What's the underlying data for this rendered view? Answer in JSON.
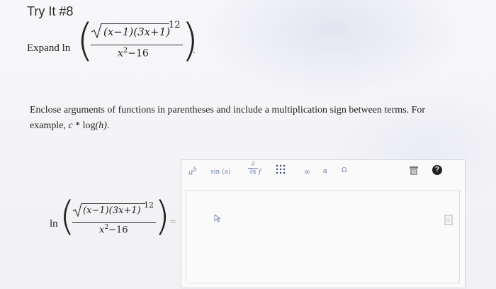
{
  "heading": "Try It #8",
  "expand": {
    "label": "Expand ln",
    "numerator": "(x−1)(3x+1)",
    "exponent": "12",
    "denominator": "x²−16",
    "denominator_base": "x",
    "denominator_power": "2",
    "denominator_rest": "−16",
    "trailing_period": "."
  },
  "instructions": {
    "line1": "Enclose arguments of functions in parentheses and include a multiplication sign between terms. For",
    "line2_prefix": "example, ",
    "line2_c": "c",
    "line2_star": " * ",
    "line2_log": "log",
    "line2_arg": "(h)",
    "line2_suffix": "."
  },
  "answer": {
    "ln_label": "ln",
    "equals": "="
  },
  "toolbar": {
    "power": "a",
    "power_sup": "b",
    "sin": "sin (a)",
    "partial_top": "∂",
    "partial_bottom": "∂x",
    "partial_f": "f",
    "grid": "∷",
    "infinity": "∞",
    "alpha": "α",
    "omega": "Ω",
    "help": "?"
  },
  "colors": {
    "toolbar_symbol": "#6b7aa8",
    "help_bg": "#222222"
  }
}
